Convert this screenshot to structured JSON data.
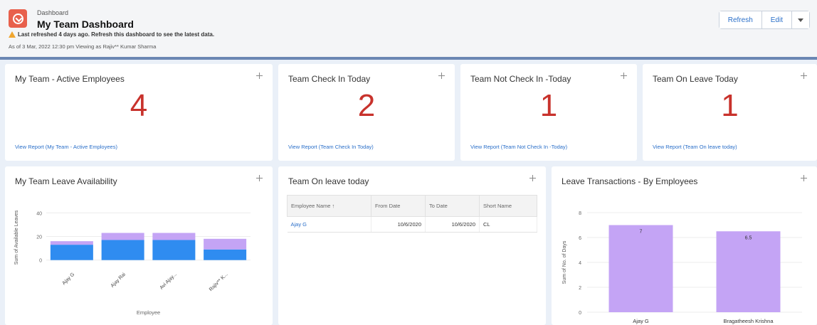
{
  "header": {
    "eyebrow": "Dashboard",
    "title": "My Team Dashboard",
    "warning": "Last refreshed 4 days ago. Refresh this dashboard to see the latest data.",
    "as_of": "As of 3 Mar, 2022 12:30 pm Viewing as Rajiv** Kumar Sharma",
    "refresh_label": "Refresh",
    "edit_label": "Edit"
  },
  "metrics": [
    {
      "title": "My Team - Active Employees",
      "value": "4",
      "link": "View Report (My Team - Active Employees)"
    },
    {
      "title": "Team Check In Today",
      "value": "2",
      "link": "View Report (Team Check In Today)"
    },
    {
      "title": "Team Not Check In -Today",
      "value": "1",
      "link": "View Report (Team Not Check In -Today)"
    },
    {
      "title": "Team On Leave Today",
      "value": "1",
      "link": "View Report (Team On leave today)"
    }
  ],
  "leave_availability": {
    "title": "My Team Leave Availability"
  },
  "leave_table": {
    "title": "Team On leave today",
    "columns": [
      "Employee Name ↑",
      "From Date",
      "To Date",
      "Short Name"
    ],
    "rows": [
      [
        "Ajay G",
        "10/6/2020",
        "10/6/2020",
        "CL"
      ]
    ]
  },
  "transactions": {
    "title": "Leave Transactions - By Employees"
  },
  "colors": {
    "accent": "#2a6fc9",
    "metric": "#c8322c",
    "bar_blue": "#2f8cf0",
    "bar_purple": "#c4a4f5"
  },
  "chart_data": [
    {
      "type": "bar",
      "stacked": true,
      "categories": [
        "Ajay G",
        "Ajay Rai",
        "Avi Ajay...",
        "Rajiv** K..."
      ],
      "series": [
        {
          "values": [
            13,
            17,
            17,
            9
          ]
        },
        {
          "values": [
            3,
            6,
            6,
            9
          ]
        }
      ],
      "xlabel": "Employee",
      "ylabel": "Sum of Available Leaves",
      "yticks": [
        0,
        20,
        40
      ],
      "ylim": [
        -5,
        45
      ]
    },
    {
      "type": "bar",
      "categories": [
        "Ajay G",
        "Bragatheesh Krishna"
      ],
      "values": [
        7,
        6.5
      ],
      "data_labels": [
        "7",
        "6.5"
      ],
      "ylabel": "Sum of No. of Days",
      "yticks": [
        0,
        2,
        4,
        6,
        8
      ],
      "ylim": [
        0,
        8
      ]
    }
  ]
}
